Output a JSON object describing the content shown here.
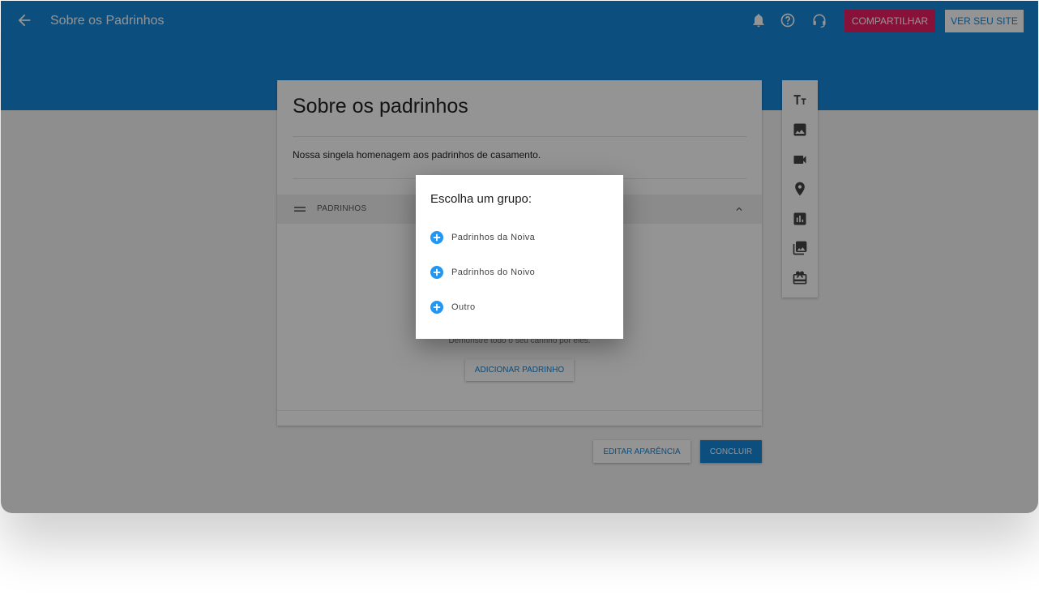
{
  "header": {
    "title": "Sobre os Padrinhos",
    "icons": [
      "arrow-left-icon",
      "bell-icon",
      "help-icon",
      "support-icon"
    ],
    "share_label": "COMPARTILHAR",
    "view_site_label": "VER SEU SITE"
  },
  "card": {
    "title": "Sobre os padrinhos",
    "description": "Nossa singela homenagem aos padrinhos de casamento.",
    "section_label": "PADRINHOS",
    "empty_text": "Demonstre todo o seu carinho por eles.",
    "add_button": "ADICIONAR PADRINHO"
  },
  "toolbar": {
    "tools": [
      "text-size-icon",
      "image-icon",
      "video-icon",
      "location-pin-icon",
      "chart-icon",
      "gallery-icon",
      "gift-icon"
    ]
  },
  "footer": {
    "appearance_label": "EDITAR APARÊNCIA",
    "done_label": "CONCLUIR"
  },
  "dialog": {
    "title": "Escolha um grupo:",
    "options": [
      {
        "label": "Padrinhos da Noiva"
      },
      {
        "label": "Padrinhos do Noivo"
      },
      {
        "label": "Outro"
      }
    ]
  },
  "colors": {
    "primary": "#1687d8",
    "share": "#e91e63",
    "option_icon": "#2196f3"
  }
}
